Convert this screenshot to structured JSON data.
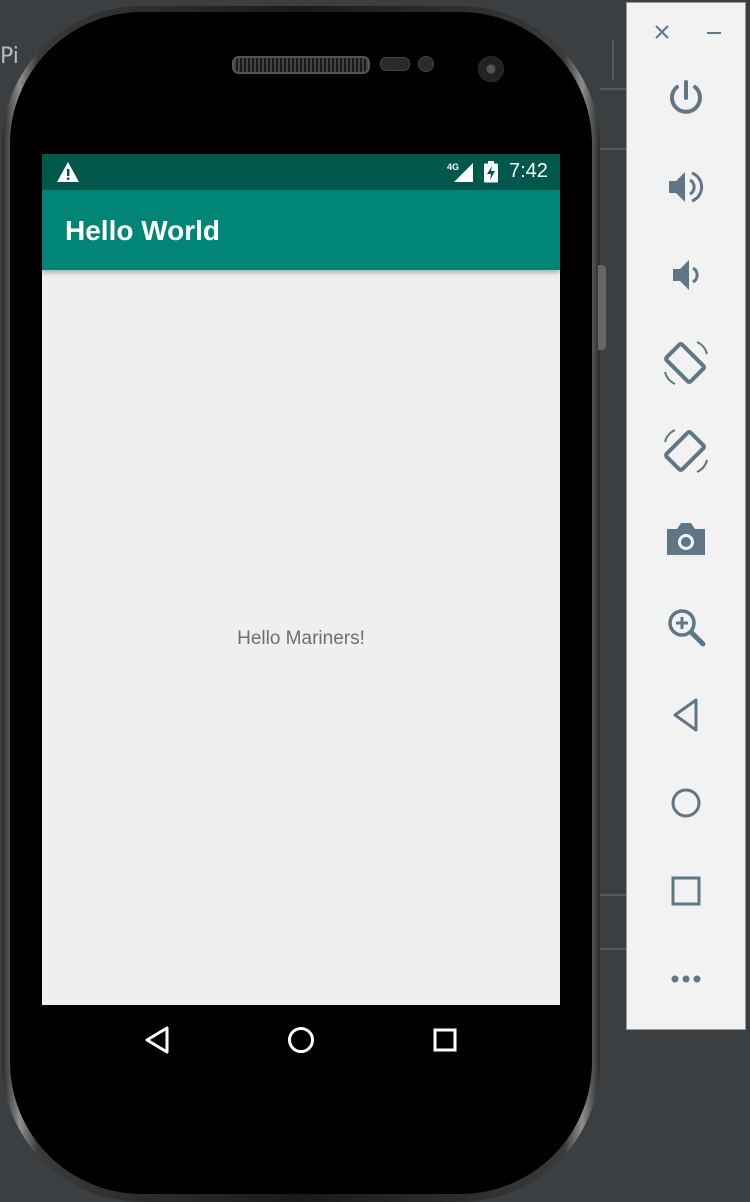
{
  "status_bar": {
    "time": "7:42",
    "network_label": "4G",
    "icons": [
      "warning-icon",
      "signal-4g-icon",
      "battery-charging-icon"
    ]
  },
  "app_bar": {
    "title": "Hello World"
  },
  "content": {
    "text": "Hello Mariners!"
  },
  "nav_bar": {
    "icons": [
      "back-icon",
      "home-icon",
      "overview-icon"
    ]
  },
  "ide": {
    "fragment_text": "Pi"
  },
  "colors": {
    "status_bar": "#00574b",
    "app_bar": "#008577",
    "screen_bg": "#efefef",
    "sidebar_icon": "#5f7785"
  },
  "emulator_sidebar": {
    "window_controls": [
      "close-icon",
      "minimize-icon"
    ],
    "buttons": [
      "power-icon",
      "volume-up-icon",
      "volume-down-icon",
      "rotate-left-icon",
      "rotate-right-icon",
      "camera-icon",
      "zoom-icon",
      "back-icon",
      "home-icon",
      "overview-icon",
      "more-icon"
    ]
  }
}
